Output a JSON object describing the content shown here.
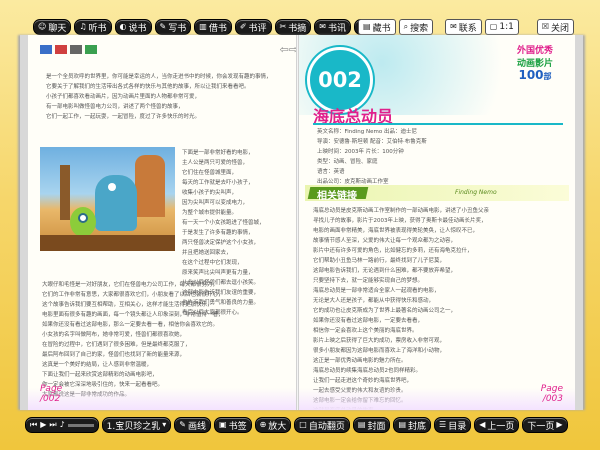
{
  "top_toolbar": {
    "left_buttons": [
      {
        "label": "聊天",
        "icon": "chat-icon"
      },
      {
        "label": "听书",
        "icon": "headphones-icon"
      },
      {
        "label": "说书",
        "icon": "speaker-icon"
      },
      {
        "label": "写书",
        "icon": "pencil-icon"
      },
      {
        "label": "借书",
        "icon": "book-icon"
      },
      {
        "label": "书评",
        "icon": "comment-icon"
      },
      {
        "label": "书摘",
        "icon": "note-icon"
      },
      {
        "label": "书讯",
        "icon": "news-icon"
      },
      {
        "label": "书友",
        "icon": "friends-icon"
      }
    ],
    "collect_label": "藏书",
    "search_label": "搜索",
    "contact_label": "联系",
    "page_ratio": "1:1",
    "close_label": "关闭"
  },
  "left_page": {
    "intro_lines": [
      "是一个全员欢呼的世界里，你可能是幸运的人，当你走进书中的时候，你会发现有趣的事情，",
      "它要关于了解我们的生活带出各式各样的快乐与其他的故事，所以让我们来看看吧。",
      "小孩子们都喜欢看动画片，因为动画片里面的人物都非常可爱，",
      "有一部电影叫做怪兽电力公司，讲述了两个怪兽的故事，",
      "它们一起工作，一起玩耍，一起冒险，度过了许多快乐的时光。"
    ],
    "side_lines": [
      "下面是一部非常好看的电影，",
      "主人公是两只可爱的怪兽，",
      "它们住在怪兽城里面，",
      "每天的工作就是去吓小孩子，",
      "收集小孩子的尖叫声，",
      "因为尖叫声可以变成电力，",
      "为整个城市提供能量。",
      "有一天一个小女孩跑进了怪兽城，",
      "于是发生了许多有趣的事情，",
      "两只怪兽决定保护这个小女孩，",
      "并且把她送回家去，",
      "在这个过程中它们发现，",
      "原来笑声比尖叫声更有力量，",
      "从此以后怪兽们都去逗小孩笑。",
      "这部电影告诉我们友谊的重要，",
      "也告诉我们勇气和善良的力量。",
      "看完以后大家都很开心。"
    ],
    "body_lines": [
      "大眼仔和毛怪是一对好朋友，它们在怪兽电力公司工作，每天都很努力，",
      "它们的工作非常有意思，大家都很喜欢它们，小朋友看了以后也会很开心，",
      "这个故事告诉我们要互相帮助，互相关心，这样才能生活得更加快乐，",
      "电影里面有很多有趣的画面，每一个镜头都让人印象深刻，非常值得一看，",
      "如果你还没有看过这部电影，那么一定要去看一看，相信你会喜欢它的。",
      "小女孩的名字叫做阿布，她非常可爱，怪兽们都很喜欢她，",
      "在冒险的过程中，它们遇到了很多困难，但是最终都克服了，",
      "最后阿布回到了自己的家，怪兽们也找到了新的能量来源，",
      "这真是一个美好的结局，让人感到非常温暖，",
      "下面让我们一起来欣赏这部精彩的动画电影吧，",
      "你一定会被它深深地吸引住的，快来一起看看吧。",
      "大家都说这是一部非常成功的作品。"
    ],
    "page_label": "Page",
    "page_number": "/002"
  },
  "right_page": {
    "number": "002",
    "title": "海底总动员",
    "badge_line1": "外国优秀",
    "badge_line2": "动画影片",
    "badge_line3": "100",
    "badge_suffix": "部",
    "info_lines": [
      "英文名称：Finding Nemo  出品：迪士尼",
      "导演：安德鲁·斯坦顿  配音：艾伯特·布鲁克斯",
      "上映时间：2003年  片长：100分钟",
      "类型：动画、冒险、家庭",
      "语言：英语",
      "出品公司：皮克斯动画工作室"
    ],
    "section_title": "相关链接",
    "section_subtitle": "Finding Nemo",
    "body_lines": [
      "海底总动员是皮克斯动画工作室制作的一部动画电影，讲述了小丑鱼父亲",
      "寻找儿子的故事，影片于2003年上映，获得了奥斯卡最佳动画长片奖，",
      "电影的画面非常精美，海底世界被表现得美轮美奂，让人惊叹不已，",
      "故事情节感人至深，父爱的伟大让每一个观众都为之动容，",
      "影片中还有许多可爱的角色，比如健忘的多莉，还有海龟克拉什，",
      "它们帮助小丑鱼马林一路前行，最终找到了儿子尼莫，",
      "这部电影告诉我们，无论遇到什么困难，都不要放弃希望，",
      "只要坚持下去，就一定能够实现自己的梦想。",
      "海底总动员是一部非常适合全家人一起观看的电影，",
      "无论是大人还是孩子，都能从中获得快乐和感动，",
      "它的成功也让皮克斯成为了世界上最著名的动画公司之一，",
      "如果你还没有看过这部电影，一定要去看看，",
      "相信你一定会喜欢上这个美丽的海底世界。",
      "影片上映之后获得了巨大的成功，票房收入非常可观，",
      "很多小朋友都因为这部电影而喜欢上了海洋和小动物，",
      "这正是一部优秀动画电影的魅力所在。",
      "海底总动员的续集海底总动员2也同样精彩。",
      "让我们一起走进这个奇妙的海底世界吧，",
      "一起去感受父爱的伟大和友谊的珍贵。",
      "这部电影一定会给你留下难忘的回忆。",
      "这就是海底总动员的故事。"
    ],
    "page_label": "Page",
    "page_number": "/003"
  },
  "bottom_toolbar": {
    "chapter": "1.宝贝珍之乳",
    "draw_label": "画线",
    "bookmark_label": "书签",
    "zoom_label": "放大",
    "autoflip_label": "自动翻页",
    "cover_label": "封面",
    "back_cover_label": "封底",
    "toc_label": "目录",
    "prev_label": "上一页",
    "next_label": "下一页"
  },
  "colors": {
    "accent": "#e0208c",
    "cyan": "#19b8c8",
    "teal": "#0e9eb0",
    "dark": "#1b1b1b"
  }
}
